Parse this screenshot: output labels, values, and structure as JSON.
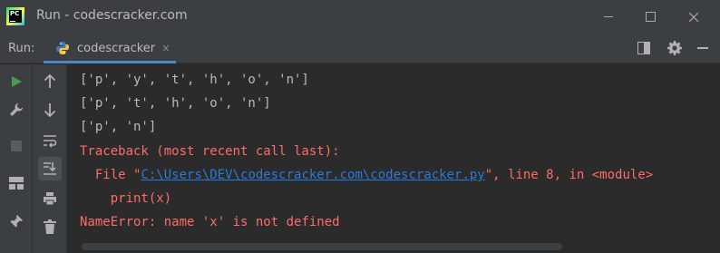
{
  "window": {
    "title": "Run - codescracker.com"
  },
  "run_panel": {
    "label": "Run:",
    "tab_label": "codescracker",
    "tab_close": "×"
  },
  "console": {
    "lines": [
      {
        "text": "['p', 'y', 't', 'h', 'o', 'n']"
      },
      {
        "text": "['p', 't', 'h', 'o', 'n']"
      },
      {
        "text": "['p', 'n']"
      },
      {
        "text": "Traceback (most recent call last):"
      },
      {
        "prefix": "  File \"",
        "link": "C:\\Users\\DEV\\codescracker.com\\codescracker.py",
        "suffix": "\", line 8, in <module>"
      },
      {
        "text": "    print(x)"
      },
      {
        "text": "NameError: name 'x' is not defined"
      }
    ]
  },
  "colors": {
    "output": "#bbbbbb",
    "error": "#ff6b68",
    "link": "#287bde",
    "run_green": "#499c54"
  },
  "icons": {
    "gutter": [
      "run-icon",
      "wrench-icon",
      "stop-icon",
      "layout-icon",
      "pin-icon"
    ],
    "toolbar": [
      "arrow-up-icon",
      "arrow-down-icon",
      "soft-wrap-icon",
      "scroll-to-end-icon",
      "print-icon",
      "trash-icon"
    ]
  }
}
